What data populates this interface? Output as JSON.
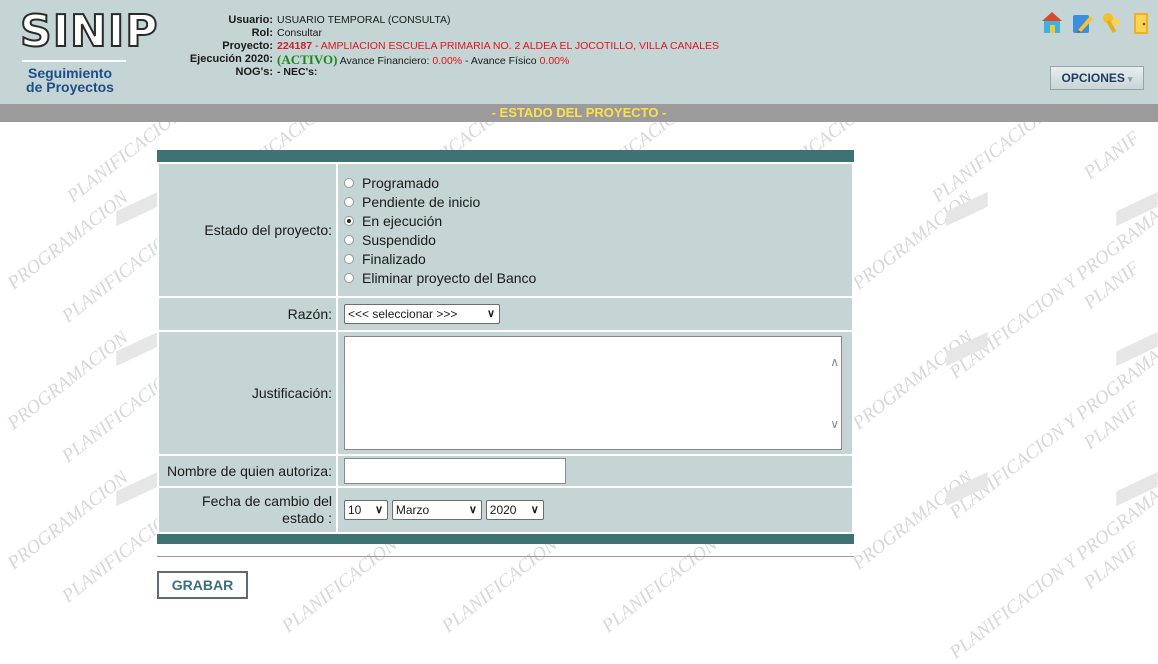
{
  "logo": {
    "mark": "SINIP",
    "subtitle_1": "Seguimiento",
    "subtitle_2": "de Proyectos"
  },
  "header": {
    "usuario_key": "Usuario:",
    "usuario_val": "USUARIO TEMPORAL (CONSULTA)",
    "rol_key": "Rol:",
    "rol_val": "Consultar",
    "proyecto_key": "Proyecto:",
    "proyecto_code": "224187",
    "proyecto_desc": " - AMPLIACION ESCUELA PRIMARIA NO. 2 ALDEA EL JOCOTILLO, VILLA CANALES",
    "ejecucion_key": "Ejecución 2020:",
    "ejecucion_status": "(ACTIVO)",
    "avance_fin_label": " Avance Financiero: ",
    "avance_fin_val": "0.00%",
    "avance_fis_label": " - Avance Físico ",
    "avance_fis_val": "0.00%",
    "nog_key": "NOG's:",
    "nog_val": " - NEC's:"
  },
  "toolbar_icons": [
    "home-icon",
    "edit-pencil-icon",
    "keys-icon",
    "exit-door-icon"
  ],
  "opciones_label": "OPCIONES",
  "page_title": "- ESTADO DEL PROYECTO -",
  "form": {
    "estado_label": "Estado del proyecto:",
    "estado_options": [
      "Programado",
      "Pendiente de inicio",
      "En ejecución",
      "Suspendido",
      "Finalizado",
      "Eliminar proyecto del Banco"
    ],
    "estado_selected": "En ejecución",
    "razon_label": "Razón:",
    "razon_value": "<<< seleccionar >>>",
    "justificacion_label": "Justificación:",
    "autoriza_label": "Nombre de quien autoriza:",
    "fecha_label_1": "Fecha de cambio del",
    "fecha_label_2": "estado :",
    "fecha_dia": "10",
    "fecha_mes": "Marzo",
    "fecha_anio": "2020"
  },
  "grabar_label": "GRABAR",
  "colors": {
    "header_bg": "#c5d4d4",
    "bar": "#3e7375",
    "title_text": "#ffe04a",
    "red": "#e0151b"
  }
}
